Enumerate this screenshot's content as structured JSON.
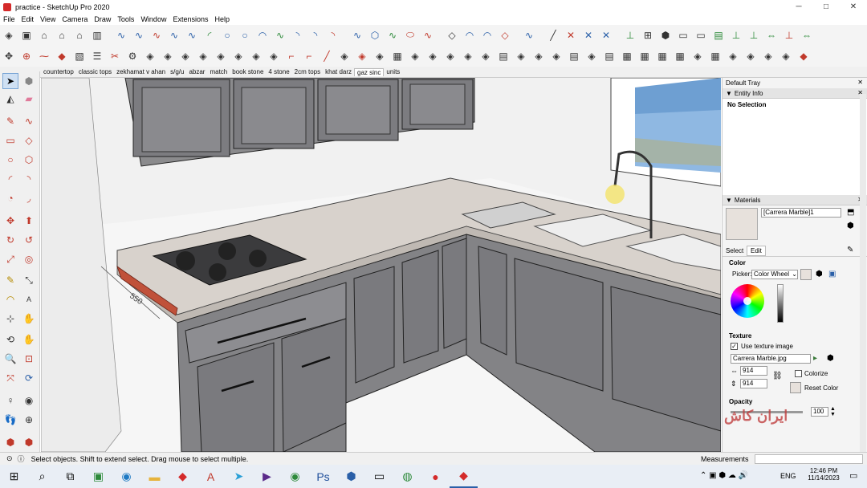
{
  "window": {
    "title": "practice - SketchUp Pro 2020",
    "controls": [
      "─",
      "□",
      "✕"
    ]
  },
  "menu": [
    "File",
    "Edit",
    "View",
    "Camera",
    "Draw",
    "Tools",
    "Window",
    "Extensions",
    "Help"
  ],
  "scenes": [
    "countertop",
    "classic tops",
    "zekhamat v ahan",
    "s/g/u",
    "abzar",
    "match",
    "book stone",
    "4 stone",
    "2cm tops",
    "khat darz",
    "gaz sinc",
    "units"
  ],
  "active_scene": "gaz sinc",
  "tray": {
    "title": "Default Tray",
    "entity_info": {
      "header": "Entity Info",
      "value": "No Selection"
    },
    "materials": {
      "header": "Materials",
      "material_name": "[Carrera Marble]1",
      "tabs": [
        "Select",
        "Edit"
      ],
      "color_label": "Color",
      "picker_label": "Picker:",
      "picker_value": "Color Wheel",
      "texture_label": "Texture",
      "use_texture": "Use texture image",
      "texture_file": "Carrera Marble.jpg",
      "width": "914",
      "height": "914",
      "colorize": "Colorize",
      "reset_color": "Reset Color",
      "opacity_label": "Opacity",
      "opacity_value": "100"
    }
  },
  "status": {
    "hint": "Select objects. Shift to extend select. Drag mouse to select multiple.",
    "measurements_label": "Measurements"
  },
  "viewport": {
    "dimension_text": "550"
  },
  "watermark": "ایران کاش",
  "taskbar": {
    "lang": "ENG",
    "time": "12:46 PM",
    "date": "11/14/2023"
  }
}
